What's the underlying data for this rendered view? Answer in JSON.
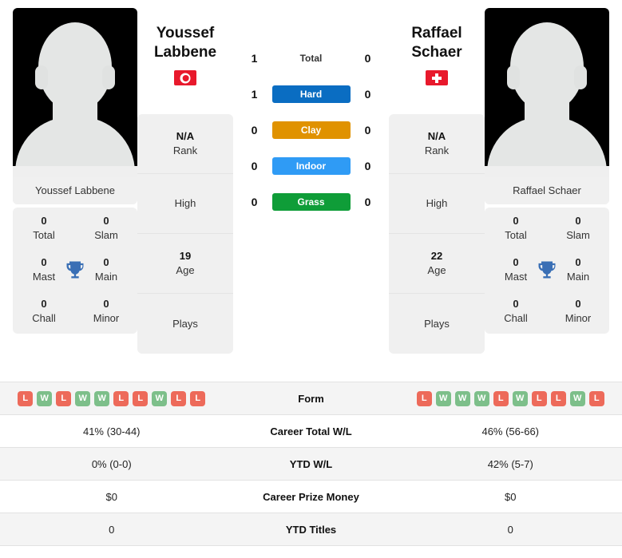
{
  "players": {
    "left": {
      "first_name": "Youssef",
      "last_name": "Labbene",
      "full_name": "Youssef Labbene",
      "country_code": "TN",
      "country_name": "Tunisia",
      "rank": "N/A",
      "rank_label": "Rank",
      "high": "",
      "high_label": "High",
      "age": "19",
      "age_label": "Age",
      "plays": "",
      "plays_label": "Plays",
      "titles": {
        "total": "0",
        "total_label": "Total",
        "slam": "0",
        "slam_label": "Slam",
        "mast": "0",
        "mast_label": "Mast",
        "main": "0",
        "main_label": "Main",
        "chall": "0",
        "chall_label": "Chall",
        "minor": "0",
        "minor_label": "Minor"
      },
      "form": [
        "L",
        "W",
        "L",
        "W",
        "W",
        "L",
        "L",
        "W",
        "L",
        "L"
      ],
      "career_total_wl": "41% (30-44)",
      "ytd_wl": "0% (0-0)",
      "career_prize_money": "$0",
      "ytd_titles": "0"
    },
    "right": {
      "first_name": "Raffael",
      "last_name": "Schaer",
      "full_name": "Raffael Schaer",
      "country_code": "CH",
      "country_name": "Switzerland",
      "rank": "N/A",
      "rank_label": "Rank",
      "high": "",
      "high_label": "High",
      "age": "22",
      "age_label": "Age",
      "plays": "",
      "plays_label": "Plays",
      "titles": {
        "total": "0",
        "total_label": "Total",
        "slam": "0",
        "slam_label": "Slam",
        "mast": "0",
        "mast_label": "Mast",
        "main": "0",
        "main_label": "Main",
        "chall": "0",
        "chall_label": "Chall",
        "minor": "0",
        "minor_label": "Minor"
      },
      "form": [
        "L",
        "W",
        "W",
        "W",
        "L",
        "W",
        "L",
        "L",
        "W",
        "L"
      ],
      "career_total_wl": "46% (56-66)",
      "ytd_wl": "42% (5-7)",
      "career_prize_money": "$0",
      "ytd_titles": "0"
    }
  },
  "h2h": {
    "rows": [
      {
        "label": "Total",
        "left": "1",
        "right": "0",
        "color": "",
        "surface": false
      },
      {
        "label": "Hard",
        "left": "1",
        "right": "0",
        "color": "#0a6dc2",
        "surface": true
      },
      {
        "label": "Clay",
        "left": "0",
        "right": "0",
        "color": "#e09200",
        "surface": true
      },
      {
        "label": "Indoor",
        "left": "0",
        "right": "0",
        "color": "#2f9bf5",
        "surface": true
      },
      {
        "label": "Grass",
        "left": "0",
        "right": "0",
        "color": "#0f9d38",
        "surface": true
      }
    ]
  },
  "stats_table": {
    "rows": [
      {
        "label": "Form",
        "left": "",
        "right": "",
        "type": "form"
      },
      {
        "label": "Career Total W/L",
        "left": "41% (30-44)",
        "right": "46% (56-66)",
        "type": "text"
      },
      {
        "label": "YTD W/L",
        "left": "0% (0-0)",
        "right": "42% (5-7)",
        "type": "text"
      },
      {
        "label": "Career Prize Money",
        "left": "$0",
        "right": "$0",
        "type": "text"
      },
      {
        "label": "YTD Titles",
        "left": "0",
        "right": "0",
        "type": "text"
      }
    ]
  },
  "colors": {
    "hard": "#0a6dc2",
    "clay": "#e09200",
    "indoor": "#2f9bf5",
    "grass": "#0f9d38",
    "win": "#7dbf8a",
    "loss": "#ed6a5a",
    "trophy": "#3a6fb5",
    "card_bg": "#f0f0f0"
  },
  "icons": {
    "trophy": "trophy-icon",
    "avatar": "player-silhouette-icon",
    "flag_left": "flag-tunisia-icon",
    "flag_right": "flag-switzerland-icon"
  }
}
